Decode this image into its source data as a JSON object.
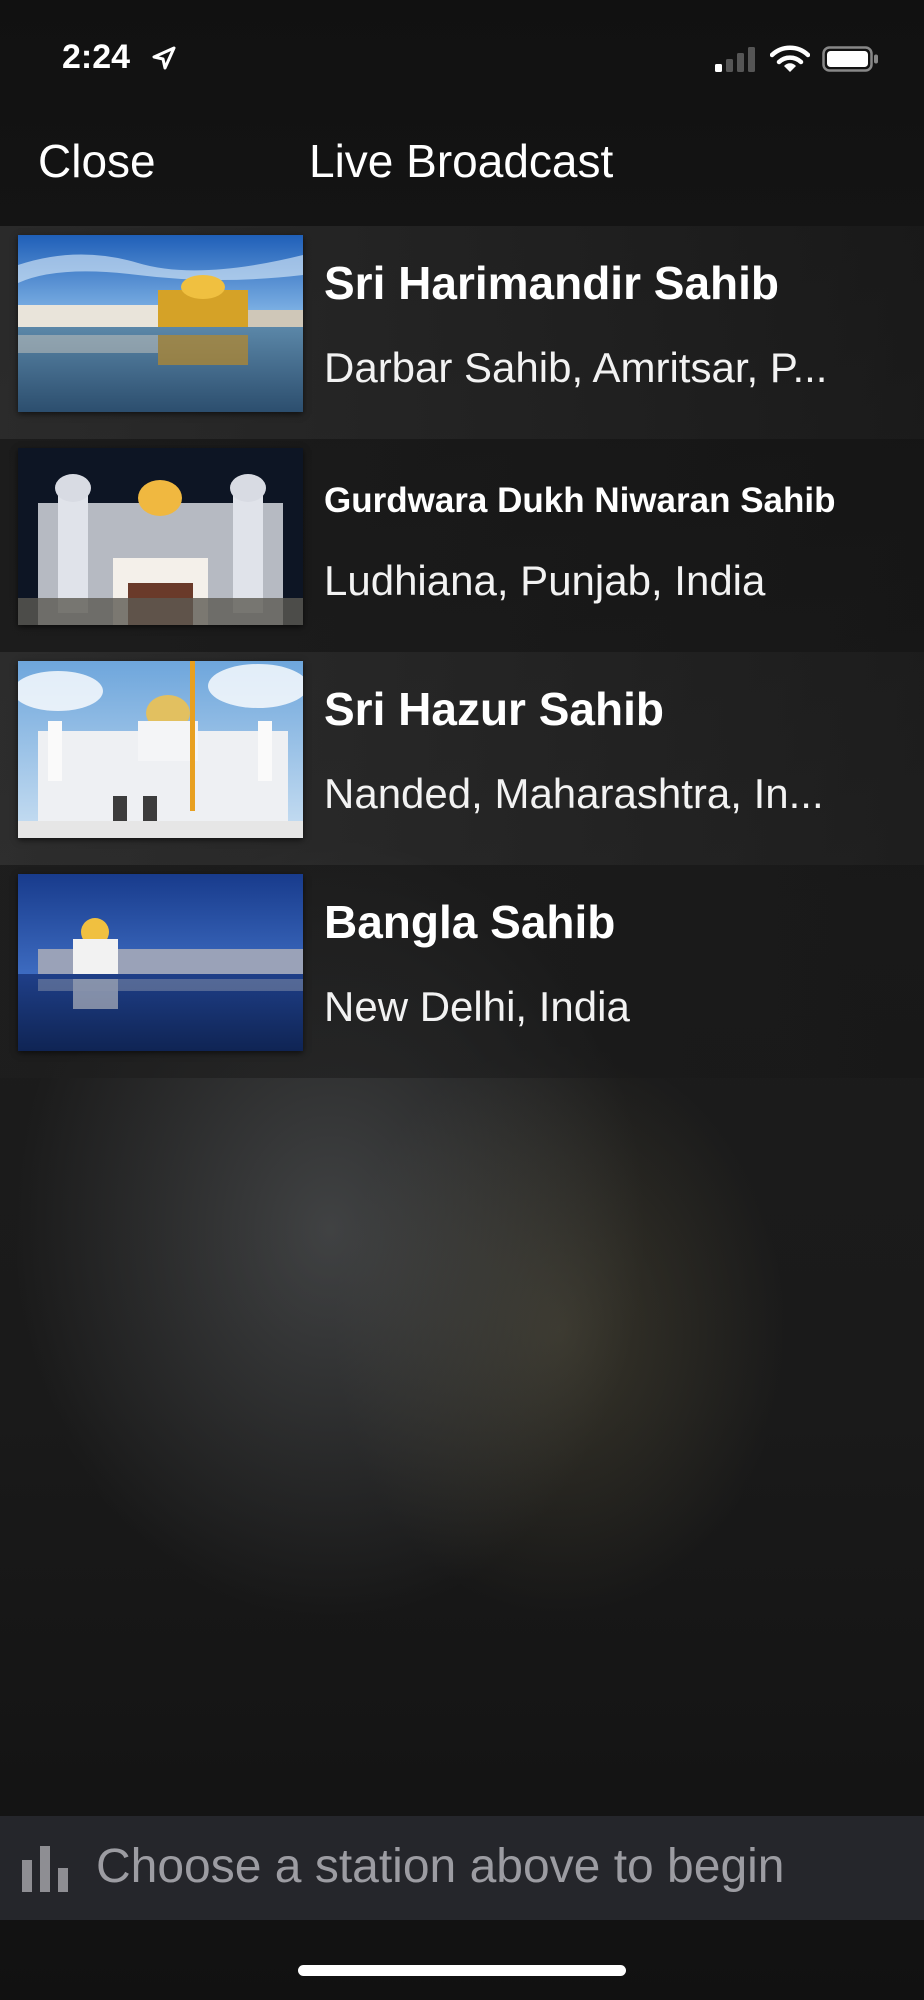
{
  "status_bar": {
    "time": "2:24",
    "icons": [
      "location-arrow-icon",
      "signal-icon",
      "wifi-icon",
      "battery-icon"
    ]
  },
  "nav": {
    "close_label": "Close",
    "title": "Live Broadcast"
  },
  "stations": [
    {
      "name": "Sri Harimandir Sahib",
      "location": "Darbar Sahib, Amritsar, P..."
    },
    {
      "name": "Gurdwara Dukh Niwaran Sahib",
      "location": "Ludhiana, Punjab, India"
    },
    {
      "name": "Sri Hazur Sahib",
      "location": "Nanded, Maharashtra, In..."
    },
    {
      "name": "Bangla Sahib",
      "location": "New Delhi, India"
    }
  ],
  "now_playing": {
    "icon": "audio-bars-icon",
    "text": "Choose a station above to begin"
  },
  "colors": {
    "background": "#151515",
    "text": "#ffffff",
    "muted_text": "#9c9ca2",
    "bottom_bar": "#25262b"
  }
}
